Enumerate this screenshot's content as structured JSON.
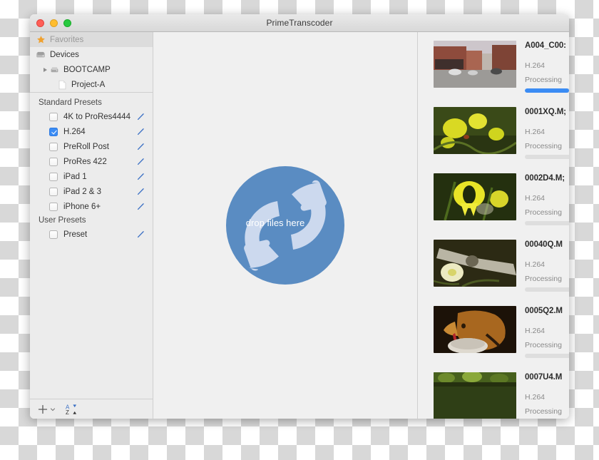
{
  "window": {
    "title": "PrimeTranscoder",
    "traffic_lights": [
      "close",
      "minimize",
      "zoom"
    ]
  },
  "sidebar": {
    "places": [
      {
        "label": "Favorites",
        "icon": "star-icon",
        "selected": true,
        "indent": 0
      },
      {
        "label": "Devices",
        "icon": "drive-icon",
        "selected": false,
        "indent": 0
      },
      {
        "label": "BOOTCAMP",
        "icon": "drive-icon",
        "selected": false,
        "indent": 1,
        "disclosure": true
      },
      {
        "label": "Project-A",
        "icon": "document-icon",
        "selected": false,
        "indent": 2
      }
    ],
    "standard_presets_header": "Standard Presets",
    "standard_presets": [
      {
        "label": "4K to ProRes4444",
        "checked": false
      },
      {
        "label": "H.264",
        "checked": true
      },
      {
        "label": "PreRoll Post",
        "checked": false
      },
      {
        "label": "ProRes 422",
        "checked": false
      },
      {
        "label": "iPad 1",
        "checked": false
      },
      {
        "label": "iPad 2 & 3",
        "checked": false
      },
      {
        "label": "iPhone 6+",
        "checked": false
      }
    ],
    "user_presets_header": "User Presets",
    "user_presets": [
      {
        "label": "Preset",
        "checked": false
      }
    ],
    "toolbar": {
      "add_icon": "plus-icon",
      "add_menu_icon": "chevron-down-icon",
      "sort_icon": "sort-az-icon"
    }
  },
  "dropzone": {
    "label": "drop files here",
    "icon": "transcode-arrows-icon",
    "circle_color": "#5a8cc2",
    "arrow_color": "#ccd9ee"
  },
  "filelist": {
    "items": [
      {
        "name": "A004_C00:",
        "codec": "H.264",
        "status": "Processing",
        "progress": 75,
        "thumb": "street-with-cars"
      },
      {
        "name": "0001XQ.M;",
        "codec": "H.264",
        "status": "Processing",
        "progress": 0,
        "thumb": "yellow-flowers"
      },
      {
        "name": "0002D4.M;",
        "codec": "H.264",
        "status": "Processing",
        "progress": 0,
        "thumb": "yellow-daffodil"
      },
      {
        "name": "00040Q.M",
        "codec": "H.264",
        "status": "Processing",
        "progress": 0,
        "thumb": "white-daffodil-log"
      },
      {
        "name": "0005Q2.M",
        "codec": "H.264",
        "status": "Processing",
        "progress": 0,
        "thumb": "dog-drinking"
      },
      {
        "name": "0007U4.M",
        "codec": "H.264",
        "status": "Processing",
        "progress": 0,
        "thumb": "green-foliage"
      }
    ]
  },
  "colors": {
    "accent": "#3b8cf4",
    "star": "#f0a12e",
    "pencil": "#3a6fc4",
    "window_bg": "#ececec",
    "panel_bg": "#f0f0f0"
  }
}
